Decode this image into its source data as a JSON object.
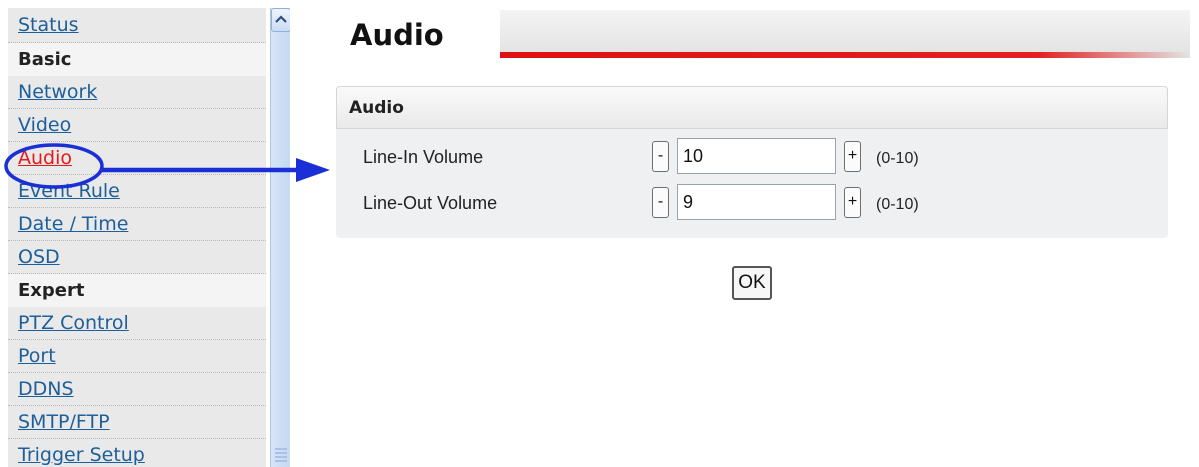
{
  "sidebar": {
    "status": "Status",
    "basic_section": "Basic",
    "basic_items": [
      "Network",
      "Video",
      "Audio",
      "Event Rule",
      "Date / Time",
      "OSD"
    ],
    "expert_section": "Expert",
    "expert_items": [
      "PTZ Control",
      "Port",
      "DDNS",
      "SMTP/FTP",
      "Trigger Setup"
    ],
    "active_item": "Audio"
  },
  "header": {
    "title": "Audio"
  },
  "panel": {
    "title": "Audio",
    "line_in": {
      "label": "Line-In Volume",
      "value": "10",
      "range": "(0-10)"
    },
    "line_out": {
      "label": "Line-Out Volume",
      "value": "9",
      "range": "(0-10)"
    },
    "minus_label": "-",
    "plus_label": "+"
  },
  "ok_label": "OK",
  "colors": {
    "link": "#1d5f9a",
    "active_link": "#e41b1b",
    "header_accent": "#dd1212",
    "annotation": "#1a2fd6"
  }
}
